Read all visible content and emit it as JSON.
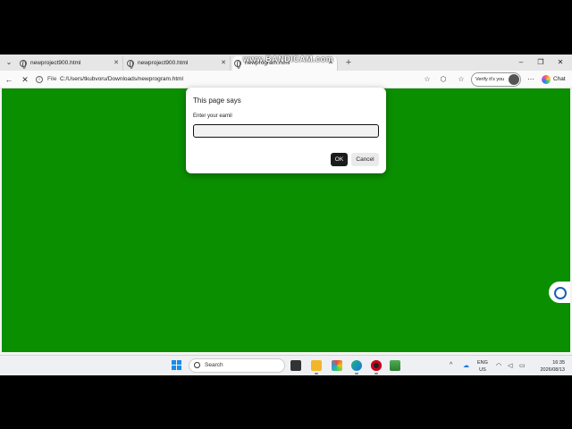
{
  "watermark": "www.BANDICAM.com",
  "tabs": [
    {
      "title": "newproject900.html",
      "active": false
    },
    {
      "title": "newproject900.html",
      "active": false
    },
    {
      "title": "newprogram.html",
      "active": true
    }
  ],
  "window_controls": {
    "minimize": "–",
    "restore": "❐",
    "close": "✕"
  },
  "address_bar": {
    "scheme_label": "File",
    "url": "C:/Users/tkubvoru/Downloads/newprogram.html"
  },
  "toolbar": {
    "verify_label": "Verify it's you",
    "chat_label": "Chat"
  },
  "page": {
    "background_color": "#0a8f00"
  },
  "dialog": {
    "title": "This page says",
    "message": "Enter your eamil",
    "input_value": "",
    "ok_label": "OK",
    "cancel_label": "Cancel"
  },
  "taskbar": {
    "search_placeholder": "Search",
    "language_line1": "ENG",
    "language_line2": "US",
    "time": "16:35",
    "date": "2026/08/13"
  }
}
